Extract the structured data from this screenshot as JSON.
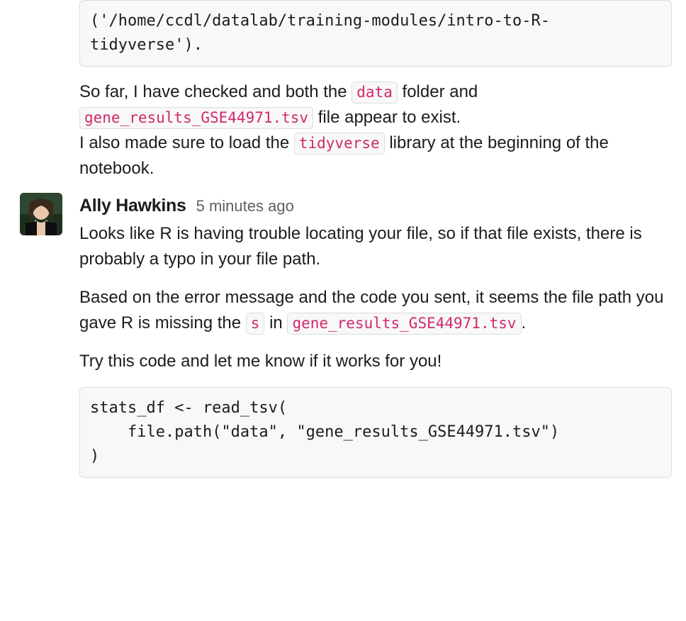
{
  "messages": [
    {
      "codeblock_top": "('/home/ccdl/datalab/training-modules/intro-to-R-tidyverse').",
      "para1": {
        "t1": "So far, I have checked and both the ",
        "c1": "data",
        "t2": " folder and ",
        "c2": "gene_results_GSE44971.tsv",
        "t3": " file appear to exist."
      },
      "para2": {
        "t1": "I also made sure to load the ",
        "c1": "tidyverse",
        "t2": " library at the beginning of the notebook."
      }
    },
    {
      "author": "Ally Hawkins",
      "time": "5 minutes ago",
      "para1": "Looks like R is having trouble locating your file, so if that file exists, there is probably a typo in your file path.",
      "para2": {
        "t1": "Based on the error message and the code you sent, it seems the file path you gave R is missing the ",
        "c1": "s",
        "t2": " in ",
        "c2": "gene_results_GSE44971.tsv",
        "t3": "."
      },
      "para3": "Try this code and let me know if it works for you!",
      "codeblock": "stats_df <- read_tsv(\n    file.path(\"data\", \"gene_results_GSE44971.tsv\")\n)"
    }
  ]
}
